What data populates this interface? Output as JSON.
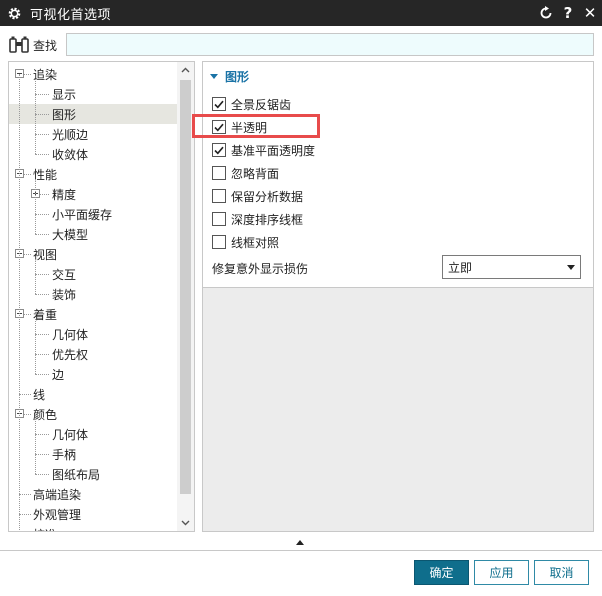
{
  "window": {
    "title": "可视化首选项",
    "controls": {
      "reset": "reset-icon",
      "help": "?",
      "close": "✕"
    }
  },
  "find": {
    "label": "查找",
    "value": ""
  },
  "tree": {
    "items": [
      {
        "label": "追染",
        "level": 0,
        "expander": "minus"
      },
      {
        "label": "显示",
        "level": 1
      },
      {
        "label": "图形",
        "level": 1,
        "selected": true
      },
      {
        "label": "光顺边",
        "level": 1
      },
      {
        "label": "收敛体",
        "level": 1
      },
      {
        "label": "性能",
        "level": 0,
        "expander": "minus"
      },
      {
        "label": "精度",
        "level": 1,
        "expander": "plus"
      },
      {
        "label": "小平面缓存",
        "level": 1
      },
      {
        "label": "大模型",
        "level": 1
      },
      {
        "label": "视图",
        "level": 0,
        "expander": "minus"
      },
      {
        "label": "交互",
        "level": 1
      },
      {
        "label": "装饰",
        "level": 1
      },
      {
        "label": "着重",
        "level": 0,
        "expander": "minus"
      },
      {
        "label": "几何体",
        "level": 1
      },
      {
        "label": "优先权",
        "level": 1
      },
      {
        "label": "边",
        "level": 1
      },
      {
        "label": "线",
        "level": 0
      },
      {
        "label": "颜色",
        "level": 0,
        "expander": "minus"
      },
      {
        "label": "几何体",
        "level": 1
      },
      {
        "label": "手柄",
        "level": 1
      },
      {
        "label": "图纸布局",
        "level": 1
      },
      {
        "label": "高端追染",
        "level": 0
      },
      {
        "label": "外观管理",
        "level": 0
      },
      {
        "label": "校准",
        "level": 0
      }
    ]
  },
  "group": {
    "title": "图形",
    "checkboxes": [
      {
        "label": "全景反锯齿",
        "checked": true
      },
      {
        "label": "半透明",
        "checked": true
      },
      {
        "label": "基准平面透明度",
        "checked": true
      },
      {
        "label": "忽略背面",
        "checked": false
      },
      {
        "label": "保留分析数据",
        "checked": false
      },
      {
        "label": "深度排序线框",
        "checked": false
      },
      {
        "label": "线框对照",
        "checked": false
      }
    ],
    "fix_label": "修复意外显示损伤",
    "fix_value": "立即"
  },
  "buttons": {
    "ok": "确定",
    "apply": "应用",
    "cancel": "取消"
  },
  "colors": {
    "titlebar": "#262626",
    "accent": "#1a73a6",
    "primary_button": "#0f6e8c",
    "highlight": "#e84b4b",
    "find_field": "#eefcfd"
  }
}
